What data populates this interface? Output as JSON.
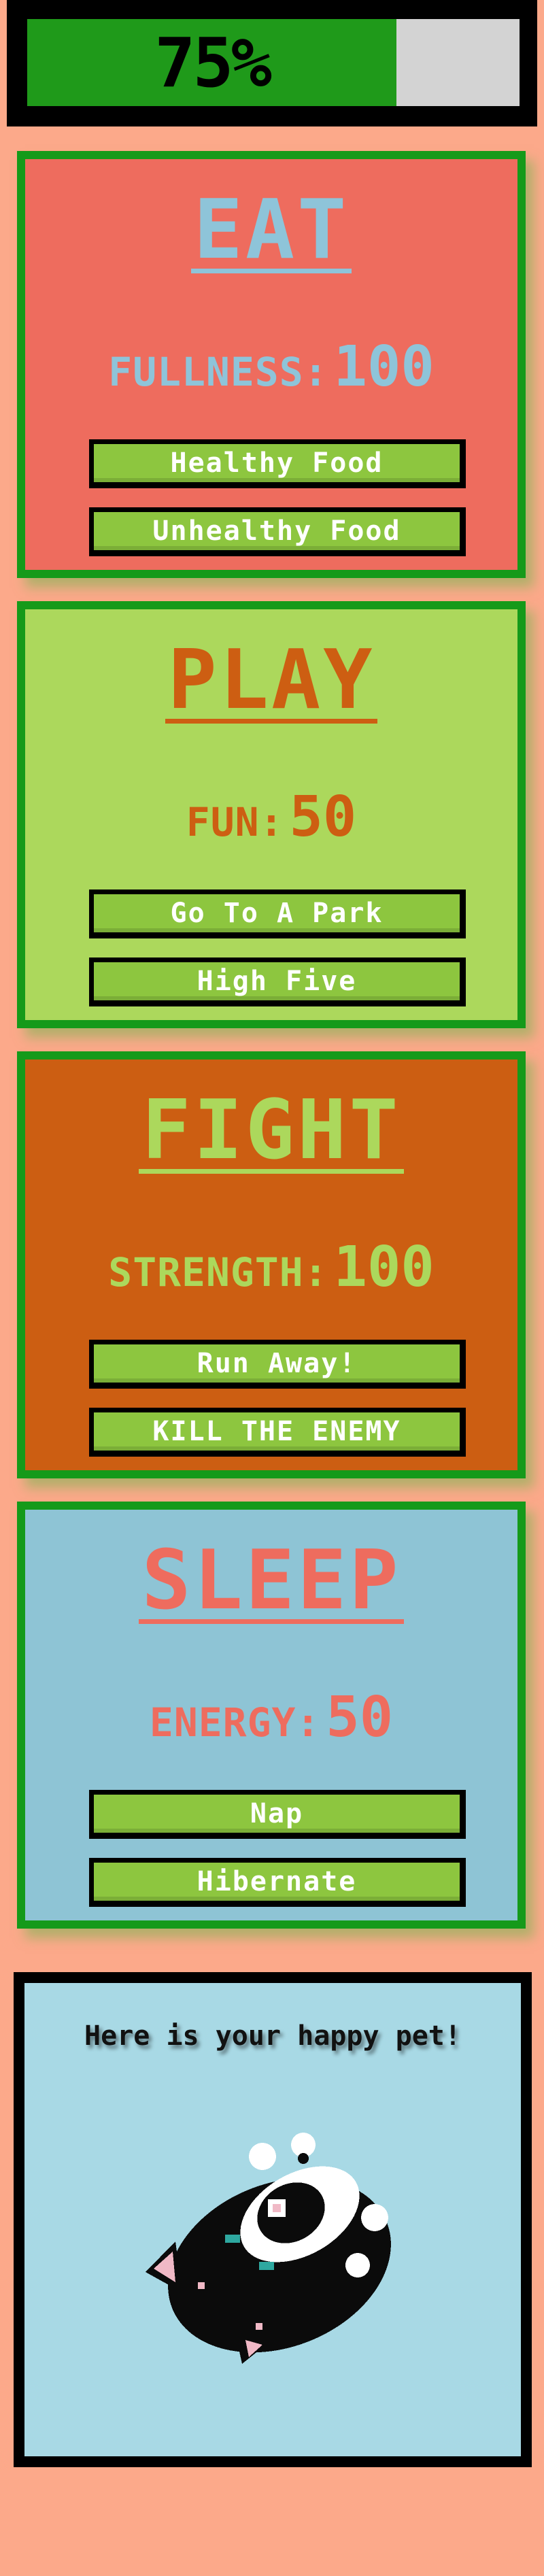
{
  "progress": {
    "label": "75%",
    "value": 75
  },
  "cards": [
    {
      "title": "EAT",
      "stat_label": "FULLNESS:",
      "stat_value": "100",
      "buttons": [
        "Healthy Food",
        "Unhealthy Food"
      ]
    },
    {
      "title": "PLAY",
      "stat_label": "FUN:",
      "stat_value": "50",
      "buttons": [
        "Go To A Park",
        "High Five"
      ]
    },
    {
      "title": "FIGHT",
      "stat_label": "STRENGTH:",
      "stat_value": "100",
      "buttons": [
        "Run Away!",
        "KILL THE ENEMY"
      ]
    },
    {
      "title": "SLEEP",
      "stat_label": "ENERGY:",
      "stat_value": "50",
      "buttons": [
        "Nap",
        "Hibernate"
      ]
    }
  ],
  "pet": {
    "caption": "Here is your happy pet!",
    "image": "pixel-cat-icon"
  },
  "colors": {
    "page_bg": "#fca98a",
    "card_border": "#159a1a",
    "button_bg": "#8dc63f",
    "eat_bg": "#ee6c5e",
    "eat_fg": "#8ec4d9",
    "play_bg": "#acd85c",
    "play_fg": "#cd5e12",
    "fight_bg": "#cc5e12",
    "fight_fg": "#acd85c",
    "sleep_bg": "#8ec4d5",
    "sleep_fg": "#ee6c5e"
  }
}
